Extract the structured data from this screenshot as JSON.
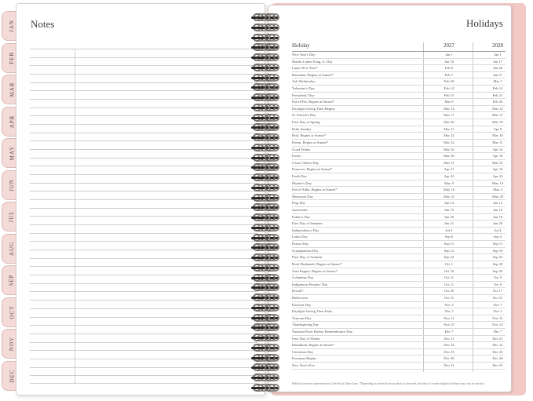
{
  "tabs": [
    "JAN",
    "FEB",
    "MAR",
    "APR",
    "MAY",
    "JUN",
    "JUL",
    "AUG",
    "SEP",
    "OCT",
    "NOV",
    "DEC"
  ],
  "left_page": {
    "title": "Notes"
  },
  "right_page": {
    "title": "Holidays",
    "columns": {
      "name": "Holiday",
      "year1": "2027",
      "year2": "2028"
    },
    "rows": [
      {
        "name": "New Year's Day",
        "y1": "Jan 1",
        "y2": "Jan 1"
      },
      {
        "name": "Martin Luther King, Jr. Day",
        "y1": "Jan 18",
        "y2": "Jan 17"
      },
      {
        "name": "Lunar New Year*",
        "y1": "Feb 6",
        "y2": "Jan 26"
      },
      {
        "name": "Ramadan, Begins at Sunset*",
        "y1": "Feb 7",
        "y2": "Jan 27"
      },
      {
        "name": "Ash Wednesday",
        "y1": "Feb 10",
        "y2": "Mar 1"
      },
      {
        "name": "Valentine's Day",
        "y1": "Feb 14",
        "y2": "Feb 14"
      },
      {
        "name": "Presidents' Day",
        "y1": "Feb 15",
        "y2": "Feb 21"
      },
      {
        "name": "Eid al-Fitr, Begins at Sunset*",
        "y1": "Mar 9",
        "y2": "Feb 26"
      },
      {
        "name": "Daylight Saving Time Begins",
        "y1": "Mar 14",
        "y2": "Mar 12"
      },
      {
        "name": "St. Patrick's Day",
        "y1": "Mar 17",
        "y2": "Mar 17"
      },
      {
        "name": "First Day of Spring",
        "y1": "Mar 20",
        "y2": "Mar 19"
      },
      {
        "name": "Palm Sunday",
        "y1": "Mar 21",
        "y2": "Apr 9"
      },
      {
        "name": "Holi, Begins at Sunset*",
        "y1": "Mar 22",
        "y2": "Mar 10"
      },
      {
        "name": "Purim, Begins at Sunset*",
        "y1": "Mar 22",
        "y2": "Mar 11"
      },
      {
        "name": "Good Friday",
        "y1": "Mar 26",
        "y2": "Apr 14"
      },
      {
        "name": "Easter",
        "y1": "Mar 28",
        "y2": "Apr 16"
      },
      {
        "name": "César Chávez Day",
        "y1": "Mar 31",
        "y2": "Mar 31"
      },
      {
        "name": "Passover, Begins at Sunset*",
        "y1": "Apr 21",
        "y2": "Apr 10"
      },
      {
        "name": "Earth Day",
        "y1": "Apr 22",
        "y2": "Apr 22"
      },
      {
        "name": "Mother's Day",
        "y1": "May 9",
        "y2": "May 14"
      },
      {
        "name": "Eid al-Adha, Begins at Sunset*",
        "y1": "May 16",
        "y2": "May 4"
      },
      {
        "name": "Memorial Day",
        "y1": "May 31",
        "y2": "May 29"
      },
      {
        "name": "Flag Day",
        "y1": "Jun 14",
        "y2": "Jun 14"
      },
      {
        "name": "Juneteenth",
        "y1": "Jun 19",
        "y2": "Jun 19"
      },
      {
        "name": "Father's Day",
        "y1": "Jun 20",
        "y2": "Jun 18"
      },
      {
        "name": "First Day of Summer",
        "y1": "Jun 21",
        "y2": "Jun 20"
      },
      {
        "name": "Independence Day",
        "y1": "Jul 4",
        "y2": "Jul 4"
      },
      {
        "name": "Labor Day",
        "y1": "Sep 6",
        "y2": "Sep 4"
      },
      {
        "name": "Patriot Day",
        "y1": "Sep 11",
        "y2": "Sep 11"
      },
      {
        "name": "Grandparents Day",
        "y1": "Sep 12",
        "y2": "Sep 10"
      },
      {
        "name": "First Day of Autumn",
        "y1": "Sep 22",
        "y2": "Sep 22"
      },
      {
        "name": "Rosh Hashanah, Begins at Sunset*",
        "y1": "Oct 1",
        "y2": "Sep 20"
      },
      {
        "name": "Yom Kippur, Begins at Sunset*",
        "y1": "Oct 10",
        "y2": "Sep 29"
      },
      {
        "name": "Columbus Day",
        "y1": "Oct 11",
        "y2": "Oct 9"
      },
      {
        "name": "Indigenous Peoples' Day",
        "y1": "Oct 11",
        "y2": "Oct 9"
      },
      {
        "name": "Diwali*",
        "y1": "Oct 29",
        "y2": "Oct 17"
      },
      {
        "name": "Halloween",
        "y1": "Oct 31",
        "y2": "Oct 31"
      },
      {
        "name": "Election Day",
        "y1": "Nov 2",
        "y2": "Nov 7"
      },
      {
        "name": "Daylight Saving Time Ends",
        "y1": "Nov 7",
        "y2": "Nov 5"
      },
      {
        "name": "Veterans Day",
        "y1": "Nov 11",
        "y2": "Nov 11"
      },
      {
        "name": "Thanksgiving Day",
        "y1": "Nov 25",
        "y2": "Nov 23"
      },
      {
        "name": "National Pearl Harbor Remembrance Day",
        "y1": "Dec 7",
        "y2": "Dec 7"
      },
      {
        "name": "First Day of Winter",
        "y1": "Dec 21",
        "y2": "Dec 21"
      },
      {
        "name": "Hanukkah, Begins at Sunset*",
        "y1": "Dec 24",
        "y2": "Dec 12"
      },
      {
        "name": "Christmas Day",
        "y1": "Dec 25",
        "y2": "Dec 25"
      },
      {
        "name": "Kwanzaa Begins",
        "y1": "Dec 26",
        "y2": "Dec 26"
      },
      {
        "name": "New Year's Eve",
        "y1": "Dec 31",
        "y2": "Dec 31"
      }
    ],
    "footnote": "Holiday/sun times representative of the Pacific Time Zone. *Depending on where the moon phase is observed, the dates of certain religious holidays may vary by one day."
  },
  "colors": {
    "tab_fill": "#f5dbd8",
    "cover_pink": "#f2c9c4",
    "spiral": "#2a2725"
  }
}
